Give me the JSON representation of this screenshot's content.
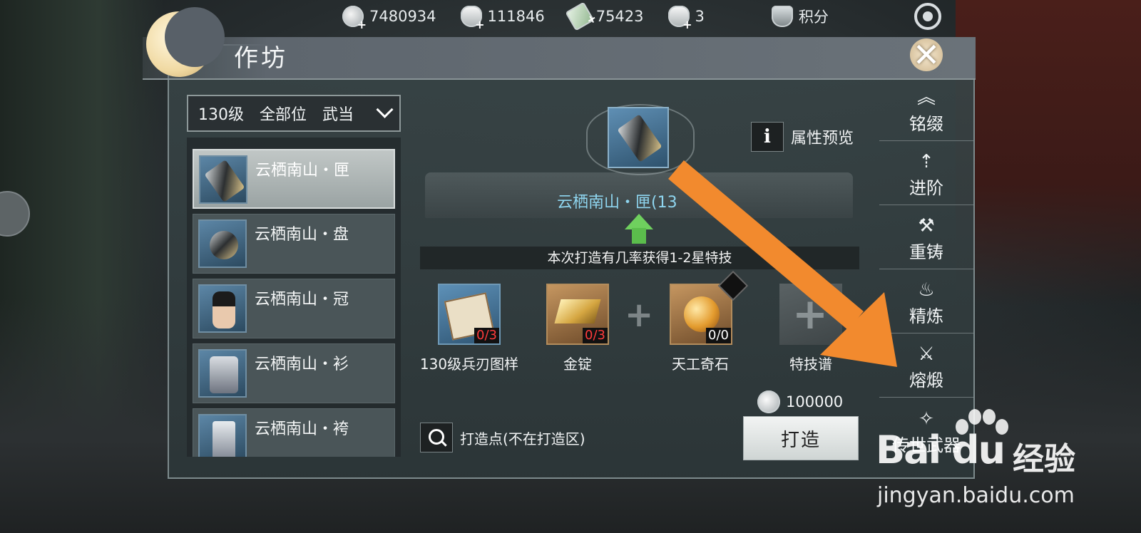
{
  "top_bar": {
    "resources": [
      {
        "icon": "coin-icon",
        "value": "7480934"
      },
      {
        "icon": "silver-ingot-icon",
        "value": "111846"
      },
      {
        "icon": "jade-ticket-icon",
        "value": "75423"
      },
      {
        "icon": "gold-bowl-icon",
        "value": "3"
      },
      {
        "icon": "shield-points-icon",
        "value": "积分"
      }
    ]
  },
  "window": {
    "title": "作坊",
    "close_label": "✕"
  },
  "filter": {
    "level": "130级",
    "slot": "全部位",
    "school": "武当"
  },
  "equipment_list": [
    {
      "name": "云栖南山・匣",
      "selected": true
    },
    {
      "name": "云栖南山・盘",
      "selected": false
    },
    {
      "name": "云栖南山・冠",
      "selected": false
    },
    {
      "name": "云栖南山・衫",
      "selected": false
    },
    {
      "name": "云栖南山・袴",
      "selected": false
    }
  ],
  "selected_item": {
    "title": "云栖南山・匣(13"
  },
  "attribute_preview_label": "属性预览",
  "notice": "本次打造有几率获得1-2星特技",
  "materials": [
    {
      "name": "130级兵刃图样",
      "count": "0/3",
      "count_color": "#ff3b3b"
    },
    {
      "name": "金锭",
      "count": "0/3",
      "count_color": "#ff3b3b"
    },
    {
      "name": "天工奇石",
      "count": "0/0",
      "count_color": "#ffffff"
    },
    {
      "name": "特技谱",
      "count": ""
    }
  ],
  "cost": "100000",
  "forge_button": "打造",
  "forge_point": "打造点(不在打造区)",
  "side_nav": [
    {
      "label": "铭缀",
      "icon": "chevron-up-icon"
    },
    {
      "label": "进阶",
      "icon": "advance-icon"
    },
    {
      "label": "重铸",
      "icon": "hammer-icon"
    },
    {
      "label": "精炼",
      "icon": "flame-icon"
    },
    {
      "label": "熔煅",
      "icon": "smelt-icon"
    },
    {
      "label": "传世武器",
      "icon": "sword-sparkle-icon"
    }
  ],
  "watermark": {
    "brand": "Bai du",
    "cn": "经验",
    "url": "jingyan.baidu.com"
  },
  "colors": {
    "highlight_arrow": "#f28a2e",
    "item_title": "#8fd6f0",
    "insufficient": "#ff3b3b",
    "upgrade_arrow": "#6fd05e"
  }
}
